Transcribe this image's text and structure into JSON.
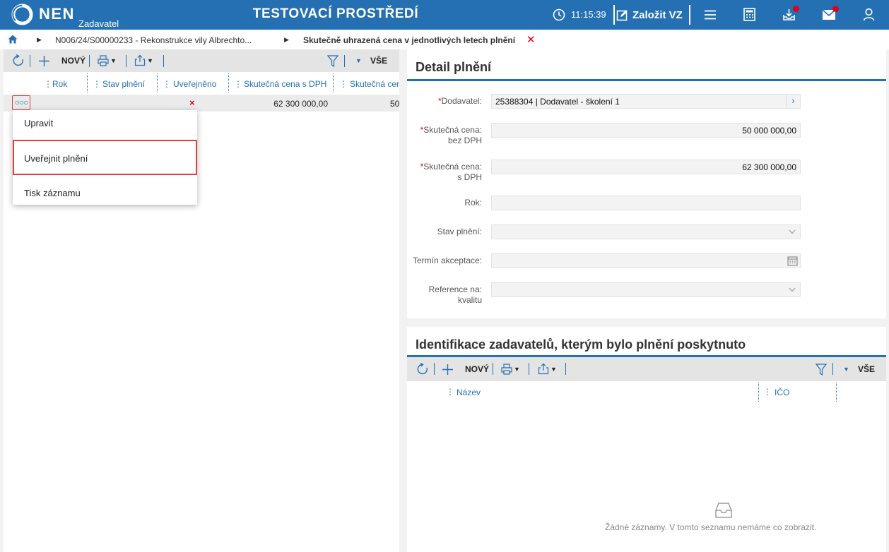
{
  "header": {
    "brand": "NEN",
    "brand_sub": "Zadavatel",
    "environment": "TESTOVACÍ PROSTŘEDÍ",
    "clock": "11:15:39",
    "create_label": "Založit VZ"
  },
  "breadcrumb": {
    "item1": "N006/24/S00000233 - Rekonstrukce vily Albrechto...",
    "item2": "Skutečně uhrazená cena v jednotlivých letech plnění"
  },
  "left": {
    "toolbar": {
      "new_label": "NOVÝ",
      "all_label": "VŠE"
    },
    "columns": [
      "Rok",
      "Stav plnění",
      "Uveřejněno",
      "Skutečná cena s DPH",
      "Skutečná cen"
    ],
    "row": {
      "published": "×",
      "price_vat": "62 300 000,00",
      "price_partial": "50"
    },
    "menu": [
      "Upravit",
      "Uveřejnit plnění",
      "Tisk záznamu"
    ]
  },
  "detail": {
    "title": "Detail plnění",
    "labels": {
      "dodavatel": "Dodavatel:",
      "cena_bez_1": "Skutečná cena:",
      "cena_bez_2": "bez DPH",
      "cena_s_1": "Skutečná cena:",
      "cena_s_2": "s DPH",
      "rok": "Rok:",
      "stav": "Stav plnění:",
      "termin": "Termín akceptace:",
      "ref_1": "Reference na:",
      "ref_2": "kvalitu"
    },
    "values": {
      "dodavatel": "25388304 | Dodavatel - školení 1",
      "cena_bez": "50 000 000,00",
      "cena_s": "62 300 000,00",
      "rok": "",
      "stav": "",
      "termin": "",
      "ref": ""
    }
  },
  "ident": {
    "title": "Identifikace zadavatelů, kterým bylo plnění poskytnuto",
    "new_label": "NOVÝ",
    "all_label": "VŠE",
    "columns": [
      "Název",
      "IČO"
    ],
    "empty_text": "Žádné záznamy. V tomto seznamu nemáme co zobrazit."
  },
  "colors": {
    "primary": "#2470b3",
    "alert": "#e0001a"
  }
}
